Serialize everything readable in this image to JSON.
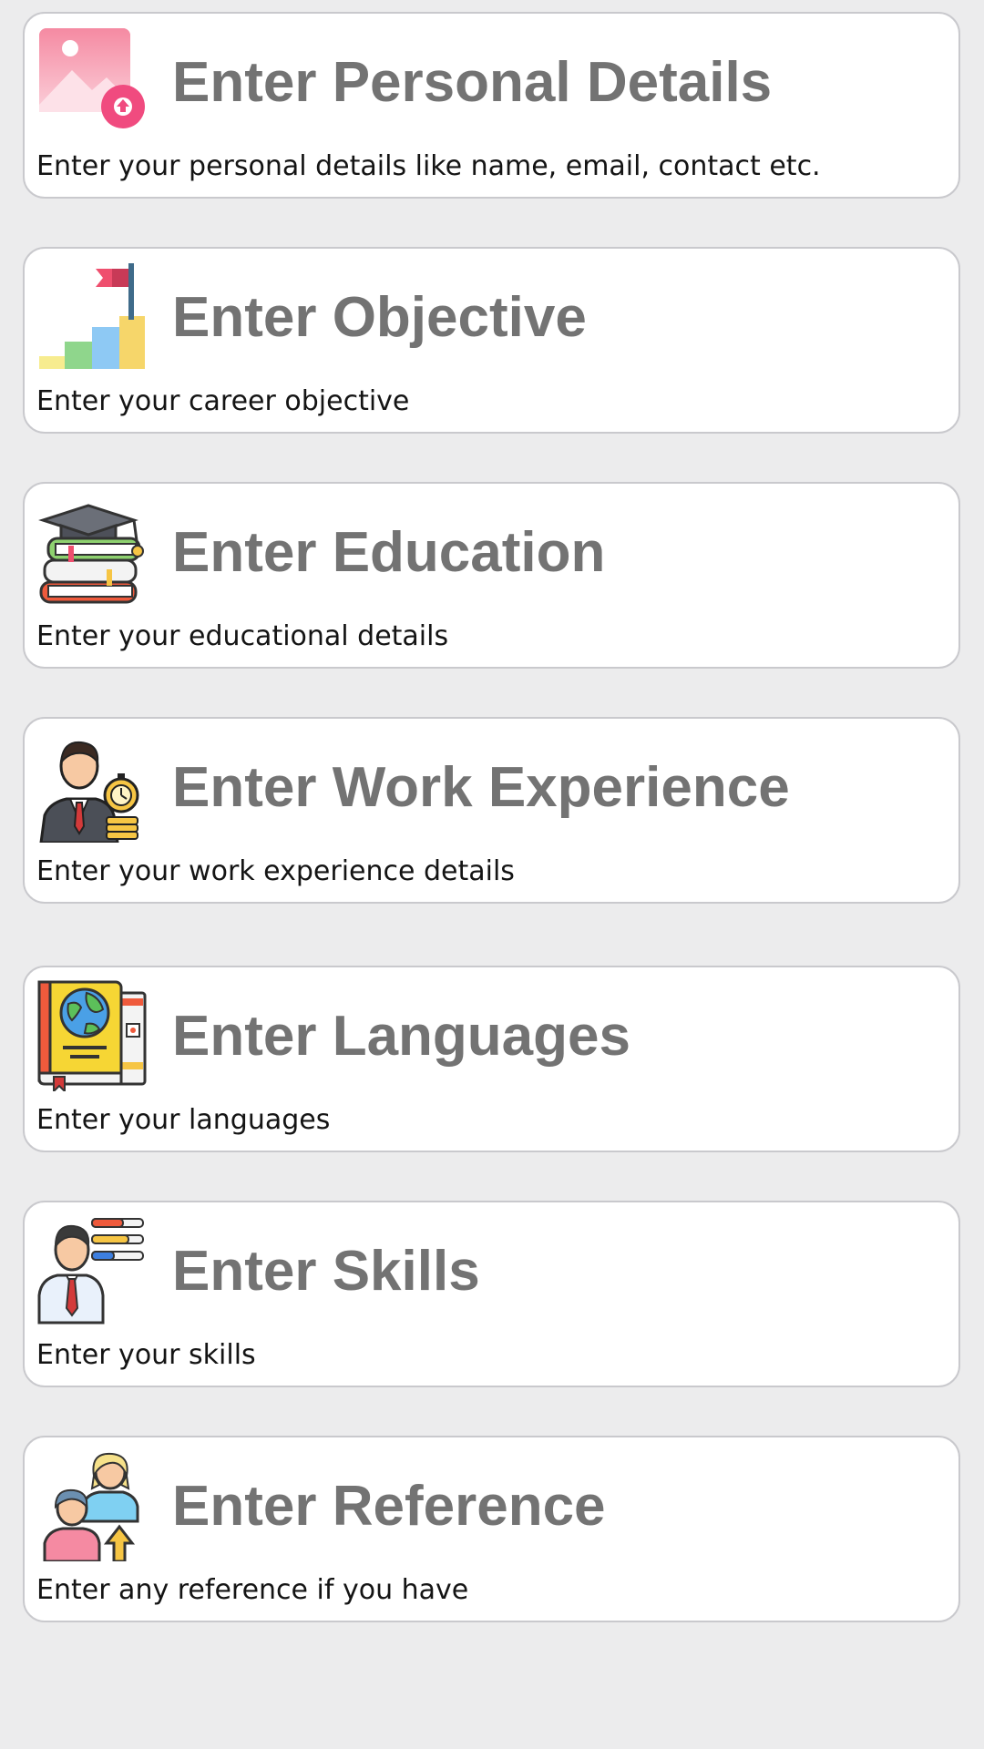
{
  "cards": [
    {
      "title": "Enter Personal Details",
      "description": "Enter your personal details like name, email, contact etc.",
      "icon": "image-upload-icon"
    },
    {
      "title": "Enter Objective",
      "description": "Enter your career objective",
      "icon": "goal-flag-steps-icon"
    },
    {
      "title": "Enter Education",
      "description": "Enter your educational details",
      "icon": "graduation-books-icon"
    },
    {
      "title": "Enter Work Experience",
      "description": "Enter your work experience details",
      "icon": "businessman-stopwatch-icon"
    },
    {
      "title": "Enter Languages",
      "description": "Enter your languages",
      "icon": "globe-book-icon"
    },
    {
      "title": "Enter Skills",
      "description": "Enter your skills",
      "icon": "person-skills-bars-icon"
    },
    {
      "title": "Enter Reference",
      "description": "Enter any reference if you have",
      "icon": "people-reference-icon"
    }
  ],
  "colors": {
    "background": "#ececed",
    "card_background": "#ffffff",
    "card_border": "#c9c9cd",
    "title_text": "#737373",
    "description_text": "#141414"
  }
}
